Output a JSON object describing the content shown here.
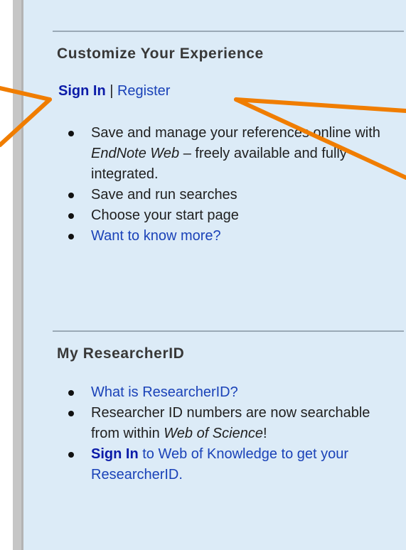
{
  "customize": {
    "title": "Customize Your Experience",
    "sign_in": "Sign In",
    "separator": " | ",
    "register": "Register",
    "items": [
      {
        "text_before": "Save and manage your references online with ",
        "em": "EndNote Web",
        "text_after": " – freely available and fully integrated."
      },
      {
        "text": "Save and run searches"
      },
      {
        "text": "Choose your start page"
      },
      {
        "link": "Want to know more?"
      }
    ]
  },
  "researcherid": {
    "title": "My ResearcherID",
    "items": [
      {
        "link": "What is ResearcherID?"
      },
      {
        "text_before": "Researcher ID numbers are now searchable from within ",
        "em": "Web of Science",
        "text_after": "!"
      },
      {
        "link_bold": "Sign In",
        "link_after": " to Web of Knowledge to get your ResearcherID."
      }
    ]
  },
  "colors": {
    "panel_background": "#dcebf7",
    "link": "#1a42b8",
    "annotation_arrow": "#f07d00"
  }
}
